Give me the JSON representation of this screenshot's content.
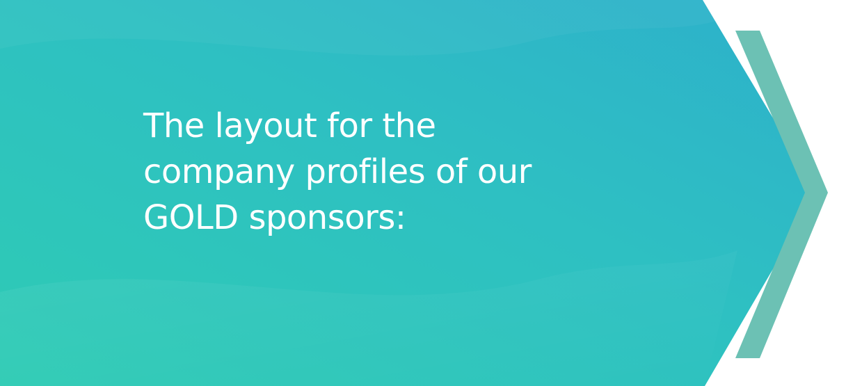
{
  "headline": {
    "lines": [
      "The layout for the",
      "company profiles of our",
      "GOLD sponsors:"
    ]
  },
  "colors": {
    "gradient_start": "#2ecbb4",
    "gradient_end": "#2db0cb",
    "chevron": "#6cc1b4",
    "text": "#ffffff",
    "background": "#ffffff"
  },
  "icons": {
    "chevron": "chevron-right-icon"
  }
}
